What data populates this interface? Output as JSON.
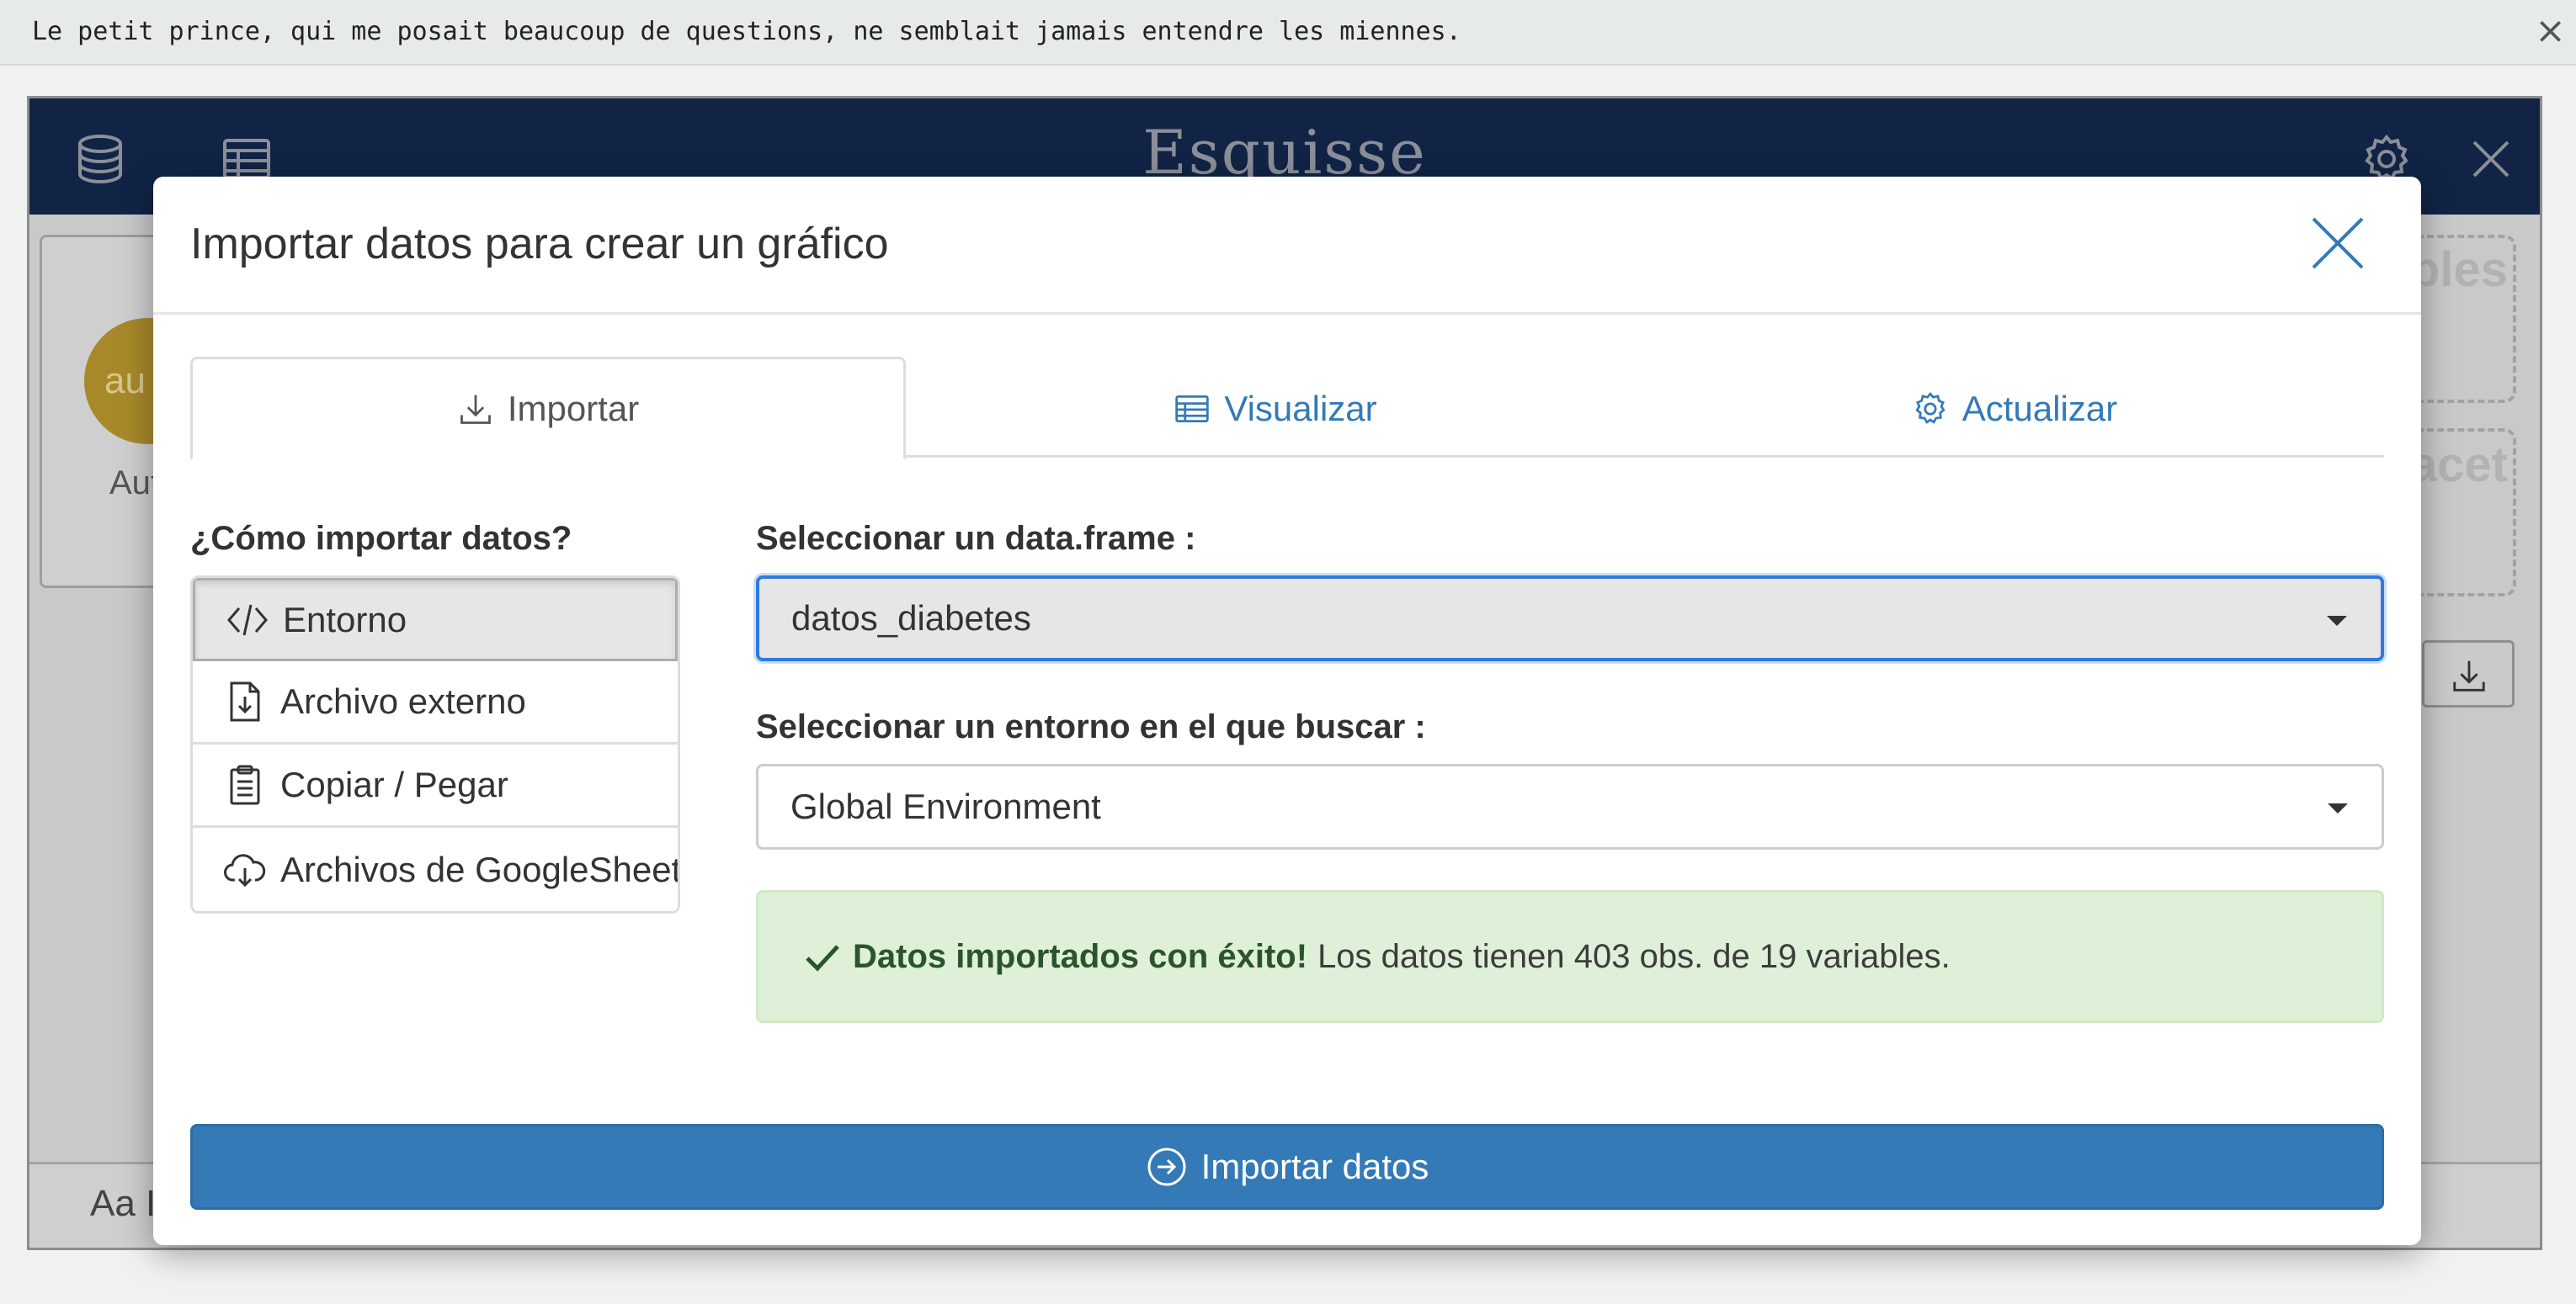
{
  "notification": {
    "text": "Le petit prince, qui me posait beaucoup de questions, ne semblait jamais entendre les miennes.",
    "close_glyph": "×"
  },
  "app": {
    "logo": "Esquisse",
    "header_icons": [
      "database-icon",
      "table-icon",
      "gear-icon",
      "close-icon"
    ],
    "background_card": {
      "badge": "au",
      "label": "Aut"
    },
    "drop_zones": [
      "ables",
      "facet"
    ],
    "footer_text": "Aa I"
  },
  "modal": {
    "title": "Importar datos para crear un gráfico",
    "tabs": [
      {
        "label": "Importar",
        "icon": "download-icon",
        "active": true
      },
      {
        "label": "Visualizar",
        "icon": "table-icon",
        "active": false
      },
      {
        "label": "Actualizar",
        "icon": "gear-icon",
        "active": false
      }
    ],
    "side_label": "¿Cómo importar datos?",
    "methods": [
      {
        "label": "Entorno",
        "icon": "code-icon",
        "active": true
      },
      {
        "label": "Archivo externo",
        "icon": "file-import-icon",
        "active": false
      },
      {
        "label": "Copiar / Pegar",
        "icon": "clipboard-icon",
        "active": false
      },
      {
        "label": "Archivos de GoogleSheet",
        "icon": "cloud-download-icon",
        "active": false
      }
    ],
    "dataframe_label": "Seleccionar un data.frame :",
    "dataframe_value": "datos_diabetes",
    "env_label": "Seleccionar un entorno en el que buscar :",
    "env_value": "Global Environment",
    "alert": {
      "strong": "Datos importados con éxito!",
      "text": "Los datos tienen 403 obs. de 19 variables.",
      "color": "#dff0d8"
    },
    "import_button": "Importar datos"
  },
  "colors": {
    "primary": "#337ab7",
    "header_bg": "#112446",
    "focus": "#2f7be0"
  }
}
